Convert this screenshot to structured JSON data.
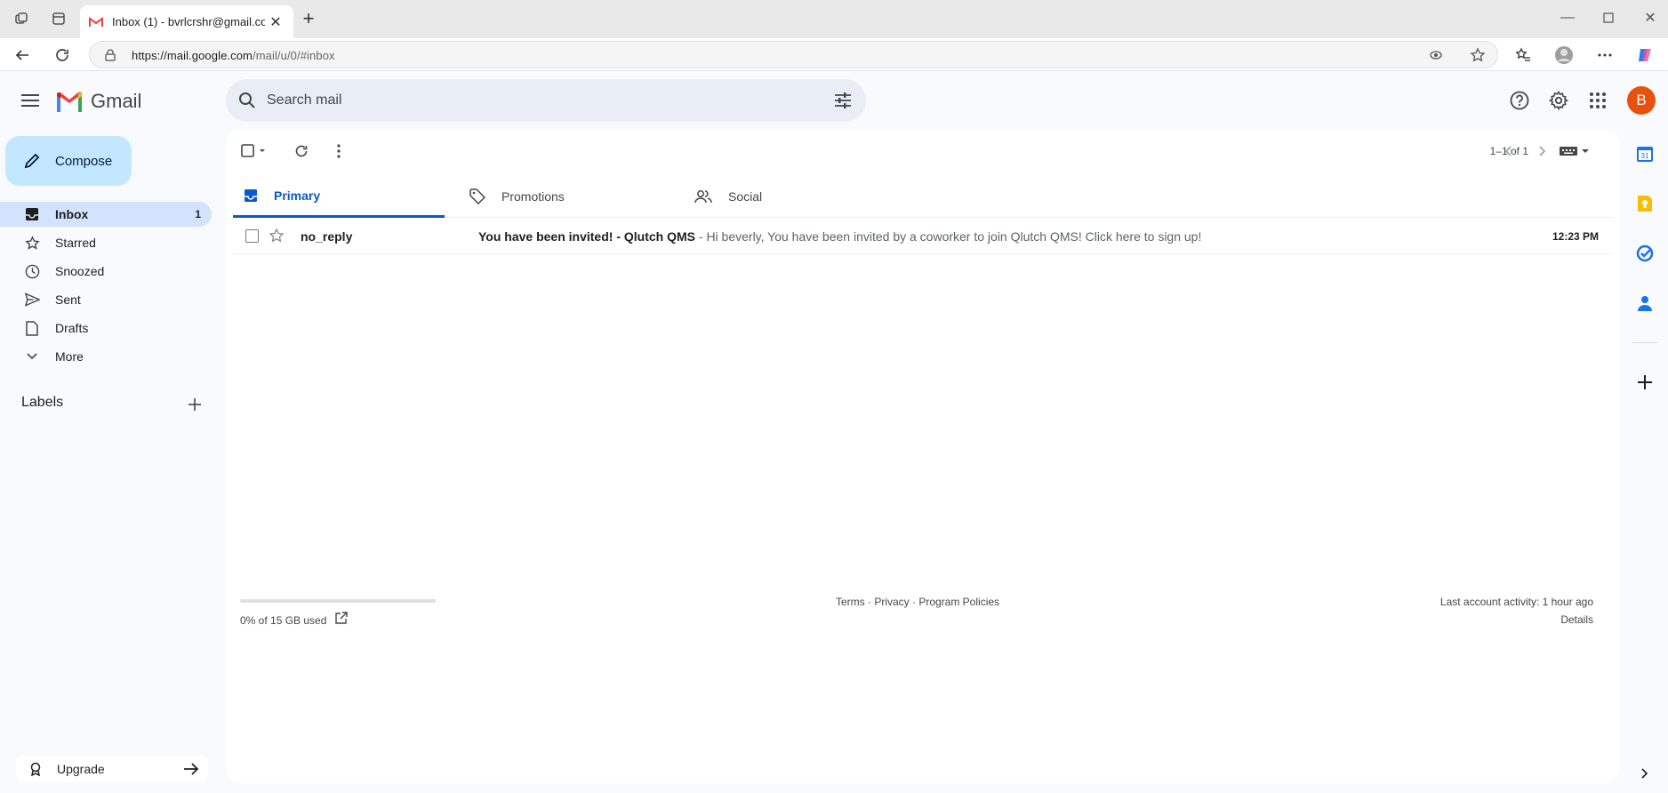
{
  "browser": {
    "tab_title": "Inbox (1) - bvrlcrshr@gmail.com",
    "url_host": "https://mail.google.com",
    "url_path": "/mail/u/0/#inbox"
  },
  "header": {
    "app_name": "Gmail",
    "search_placeholder": "Search mail",
    "avatar_letter": "B"
  },
  "sidebar": {
    "compose_label": "Compose",
    "items": [
      {
        "label": "Inbox",
        "count": "1",
        "icon": "inbox-icon"
      },
      {
        "label": "Starred",
        "count": "",
        "icon": "star-icon"
      },
      {
        "label": "Snoozed",
        "count": "",
        "icon": "clock-icon"
      },
      {
        "label": "Sent",
        "count": "",
        "icon": "send-icon"
      },
      {
        "label": "Drafts",
        "count": "",
        "icon": "draft-icon"
      },
      {
        "label": "More",
        "count": "",
        "icon": "chevron-down-icon"
      }
    ],
    "labels_title": "Labels",
    "upgrade_label": "Upgrade"
  },
  "toolbar": {
    "pagination": "1–1 of 1"
  },
  "tabs": [
    {
      "label": "Primary",
      "active": true
    },
    {
      "label": "Promotions",
      "active": false
    },
    {
      "label": "Social",
      "active": false
    }
  ],
  "emails": [
    {
      "sender": "no_reply",
      "subject": "You have been invited! - Qlutch QMS",
      "snippet": " - Hi beverly, You have been invited by a coworker to join Qlutch QMS! Click here to sign up!",
      "time": "12:23 PM"
    }
  ],
  "footer": {
    "storage_text": "0% of 15 GB used",
    "storage_fraction": 0.0,
    "links": "Terms · Privacy · Program Policies",
    "last_activity": "Last account activity: 1 hour ago",
    "details": "Details"
  },
  "colors": {
    "accent": "#0b57d0",
    "compose_bg": "#c2e7ff",
    "active_nav": "#d3e3fd",
    "avatar": "#e8500e"
  }
}
